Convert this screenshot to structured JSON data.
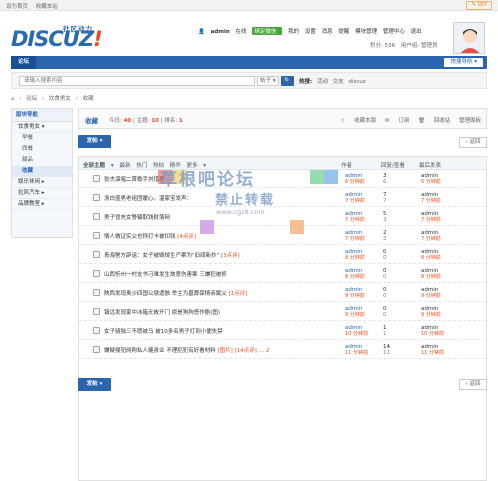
{
  "topbar": {
    "links": [
      "设为首页",
      "收藏本站"
    ],
    "diy": "DIY"
  },
  "logo": {
    "cn": "社区动力",
    "en": "DISCUZ",
    "ex": "!"
  },
  "user": {
    "name": "admin",
    "status": "在线",
    "wechat": "绑定微信",
    "links": [
      "我的",
      "设置",
      "消息",
      "提醒",
      "模块管理",
      "管理中心",
      "退出"
    ],
    "points": "积分: 536",
    "group": "用户组: 管理员"
  },
  "nav": {
    "tab": "论坛",
    "quick": "快捷导航"
  },
  "search": {
    "placeholder": "请输入搜索内容",
    "scope": "帖子",
    "button": "🔍",
    "hot_label": "热搜:",
    "hot": [
      "活动",
      "交友",
      "discuz"
    ]
  },
  "breadcrumb": [
    "⌂",
    "›",
    "论坛",
    "›",
    "饮食男女",
    "›",
    "收藏"
  ],
  "sidebar": {
    "header": "版块导航",
    "group1": "饮食男女",
    "items": [
      "早餐",
      "西餐",
      "甜品",
      "收藏"
    ],
    "groups": [
      "娱乐休闲",
      "拉风汽车",
      "品牌教室"
    ]
  },
  "forum": {
    "title": "收藏",
    "today_label": "今日:",
    "today": "40",
    "topics_label": "主题:",
    "topics": "10",
    "rank_label": "排名:",
    "rank": "1",
    "actions": [
      "收藏本版",
      "订阅",
      "回收站",
      "管理面板"
    ]
  },
  "post_label": "发帖",
  "back_label": "返回",
  "filters": [
    "全部主题",
    "最新",
    "热门",
    "热帖",
    "精华",
    "更多"
  ],
  "columns": {
    "author": "作者",
    "replies": "回复/查看",
    "last": "最后发表"
  },
  "rows": [
    {
      "title": "张杰演唱二首歌手刘惜君",
      "tag": "",
      "author": "admin",
      "date": "6 分钟前",
      "replies": "3",
      "views": "6",
      "last": "admin",
      "last_date": "6 分钟前"
    },
    {
      "title": "浙白盛男老组团暖心。温家宝发声：",
      "tag": "",
      "author": "admin",
      "date": "7 分钟前",
      "replies": "7",
      "views": "7",
      "last": "admin",
      "last_date": "7 分钟前"
    },
    {
      "title": "男子冒充女警骗取钱财落网",
      "tag": "",
      "author": "admin",
      "date": "7 分钟前",
      "replies": "5",
      "views": "3",
      "last": "admin",
      "last_date": "7 分钟前"
    },
    {
      "title": "情人做证实父也称打卡被扣钱",
      "tag": "[4点评]",
      "author": "admin",
      "date": "7 分钟前",
      "replies": "2",
      "views": "3",
      "last": "admin",
      "last_date": "7 分钟前"
    },
    {
      "title": "青海警方辟谣：女子被毁掉生产案为\"旧闻新抄\"",
      "tag": "[3点评]",
      "author": "admin",
      "date": "8 分钟前",
      "replies": "0",
      "views": "0",
      "last": "admin",
      "last_date": "8 分钟前"
    },
    {
      "title": "山西忻州一村支书刁难发生故意伤害案 三嫌犯被抓",
      "tag": "",
      "author": "admin",
      "date": "8 分钟前",
      "replies": "0",
      "views": "0",
      "last": "admin",
      "last_date": "8 分钟前"
    },
    {
      "title": "陕西发现奥沙四国公墩遗骸 举主为墓葬保情亲属父",
      "tag": "[1点评]",
      "author": "admin",
      "date": "9 分钟前",
      "replies": "0",
      "views": "0",
      "last": "admin",
      "last_date": "9 分钟前"
    },
    {
      "title": "镇远发现家中冰箱无故开门 原是狗狗恶作剧(图)",
      "tag": "",
      "author": "admin",
      "date": "9 分钟前",
      "replies": "0",
      "views": "0",
      "last": "admin",
      "last_date": "9 分钟前"
    },
    {
      "title": "女子骑独三不愿被马 被10多名男子打到小便失禁",
      "tag": "",
      "author": "admin",
      "date": "10 分钟前",
      "replies": "1",
      "views": "1",
      "last": "admin",
      "last_date": "10 分钟前"
    },
    {
      "title": "嫌疑侵犯网购私人健身业 不理犯犯有好看材料",
      "tag": "[图片] [14点评]  … 2",
      "author": "admin",
      "date": "11 分钟前",
      "replies": "14",
      "views": "11",
      "last": "admin",
      "last_date": "11 分钟前"
    }
  ],
  "watermark": {
    "line1": "草根吧论坛",
    "line2": "禁止转载",
    "line3": "www.cgz8.com"
  },
  "colors": {
    "brand": "#2b65b0",
    "accent": "#e94c1a"
  }
}
